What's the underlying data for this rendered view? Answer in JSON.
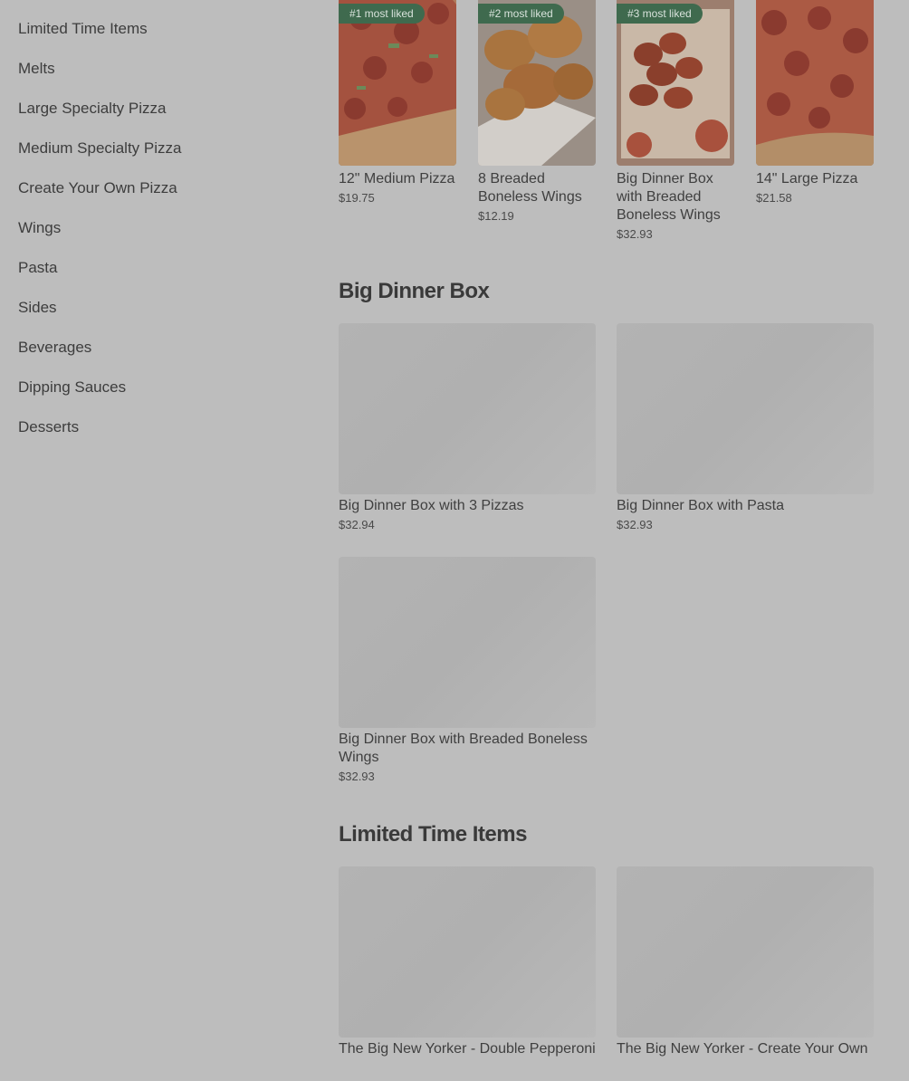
{
  "sidebar": {
    "items": [
      {
        "label": "Limited Time Items"
      },
      {
        "label": "Melts"
      },
      {
        "label": "Large Specialty Pizza"
      },
      {
        "label": "Medium Specialty Pizza"
      },
      {
        "label": "Create Your Own Pizza"
      },
      {
        "label": "Wings"
      },
      {
        "label": "Pasta"
      },
      {
        "label": "Sides"
      },
      {
        "label": "Beverages"
      },
      {
        "label": "Dipping Sauces"
      },
      {
        "label": "Desserts"
      }
    ]
  },
  "popular": [
    {
      "badge": "#1 most liked",
      "name": "12\" Medium Pizza",
      "price": "$19.75"
    },
    {
      "badge": "#2 most liked",
      "name": "8 Breaded Boneless Wings",
      "price": "$12.19"
    },
    {
      "badge": "#3 most liked",
      "name": "Big Dinner Box with Breaded Boneless Wings",
      "price": "$32.93"
    },
    {
      "badge": "",
      "name": "14\" Large Pizza",
      "price": "$21.58"
    }
  ],
  "sections": [
    {
      "title": "Big Dinner Box",
      "items": [
        {
          "name": "Big Dinner Box with 3 Pizzas",
          "price": "$32.94"
        },
        {
          "name": "Big Dinner Box with Pasta",
          "price": "$32.93"
        },
        {
          "name": "Big Dinner Box with Breaded Boneless Wings",
          "price": "$32.93"
        }
      ]
    },
    {
      "title": "Limited Time Items",
      "items": [
        {
          "name": "The Big New Yorker - Double Pepperoni",
          "price": ""
        },
        {
          "name": "The Big New Yorker - Create Your Own",
          "price": ""
        }
      ]
    }
  ],
  "colors": {
    "overlay_bg": "#bdbdbd",
    "badge_bg": "#3f6a4e",
    "text": "#3f3f3f"
  }
}
